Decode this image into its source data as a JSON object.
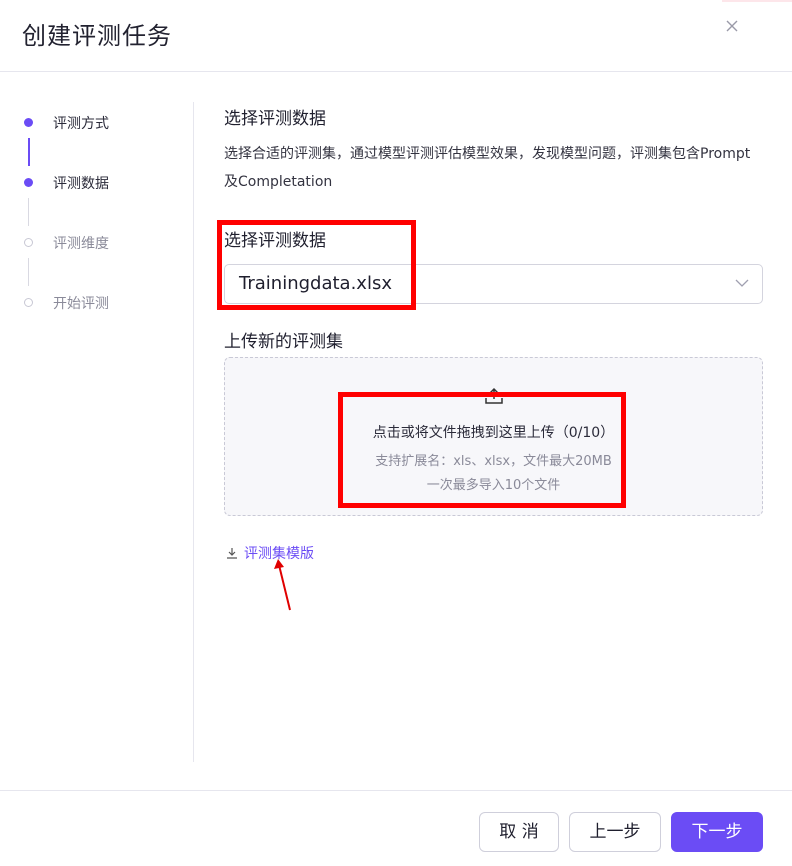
{
  "dialog": {
    "title": "创建评测任务",
    "close_icon": "close-icon"
  },
  "steps": [
    {
      "label": "评测方式",
      "state": "active"
    },
    {
      "label": "评测数据",
      "state": "active"
    },
    {
      "label": "评测维度",
      "state": "inactive"
    },
    {
      "label": "开始评测",
      "state": "inactive"
    }
  ],
  "main": {
    "section_title": "选择评测数据",
    "description": "选择合适的评测集，通过模型评测评估模型效果，发现模型问题，评测集包含Prompt及Completation",
    "select_label": "选择评测数据",
    "select_value": "Trainingdata.xlsx",
    "upload_label": "上传新的评测集",
    "upload_main": "点击或将文件拖拽到这里上传（0/10）",
    "upload_sub1": "支持扩展名：xls、xlsx，文件最大20MB",
    "upload_sub2": "一次最多导入10个文件",
    "template_link": "评测集模版"
  },
  "footer": {
    "cancel": "取 消",
    "prev": "上一步",
    "next": "下一步"
  },
  "colors": {
    "accent": "#6b4cf5",
    "annotation": "#ff0000"
  }
}
